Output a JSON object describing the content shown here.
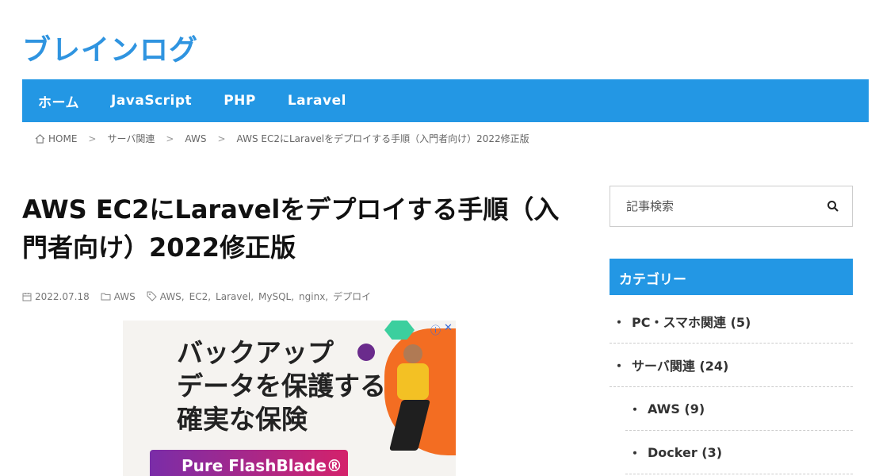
{
  "site": {
    "logo": "ブレインログ"
  },
  "nav": {
    "items": [
      "ホーム",
      "JavaScript",
      "PHP",
      "Laravel"
    ]
  },
  "breadcrumb": {
    "items": [
      "HOME",
      "サーバ関連",
      "AWS",
      "AWS EC2にLaravelをデプロイする手順（入門者向け）2022修正版"
    ],
    "separator": ">"
  },
  "post": {
    "title": "AWS EC2にLaravelをデプロイする手順（入門者向け）2022修正版",
    "date": "2022.07.18",
    "category": "AWS",
    "tags": [
      "AWS,",
      "EC2,",
      "Laravel,",
      "MySQL,",
      "nginx,",
      "デプロイ"
    ]
  },
  "ad": {
    "text": "バックアップ\nデータを保護する\n確実な保険",
    "banner": "Pure FlashBlade®",
    "badge_info": "ⓘ",
    "badge_close": "✕"
  },
  "sidebar": {
    "search_placeholder": "記事検索",
    "category_title": "カテゴリー",
    "categories": [
      {
        "label": "PC・スマホ関連 (5)",
        "child": false
      },
      {
        "label": "サーバ関連 (24)",
        "child": false
      },
      {
        "label": "AWS (9)",
        "child": true
      },
      {
        "label": "Docker (3)",
        "child": true
      }
    ]
  },
  "colors": {
    "brand": "#2397e4",
    "logo": "#2f94e0"
  },
  "icons": {
    "home": "home-icon",
    "calendar": "calendar-icon",
    "folder": "folder-icon",
    "tag": "tag-icon",
    "search": "search-icon"
  }
}
